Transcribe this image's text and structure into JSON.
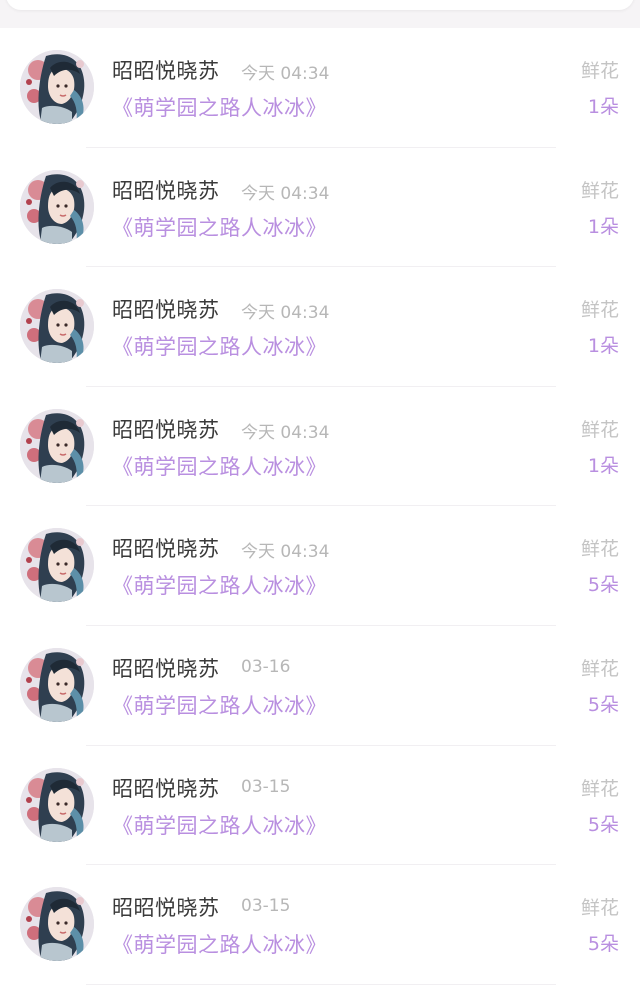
{
  "colors": {
    "accent_purple": "#b98fe0",
    "name_text": "#3a3a3a",
    "muted_text": "#b7b7b7",
    "background": "#ffffff",
    "page_background": "#f6f4f6"
  },
  "records": [
    {
      "user": "昭昭悦晓苏",
      "time": "今天 04:34",
      "book": "《萌学园之路人冰冰》",
      "gift_type": "鲜花",
      "gift_count": "1朵",
      "avatar_icon": "avatar-illustration"
    },
    {
      "user": "昭昭悦晓苏",
      "time": "今天 04:34",
      "book": "《萌学园之路人冰冰》",
      "gift_type": "鲜花",
      "gift_count": "1朵",
      "avatar_icon": "avatar-illustration"
    },
    {
      "user": "昭昭悦晓苏",
      "time": "今天 04:34",
      "book": "《萌学园之路人冰冰》",
      "gift_type": "鲜花",
      "gift_count": "1朵",
      "avatar_icon": "avatar-illustration"
    },
    {
      "user": "昭昭悦晓苏",
      "time": "今天 04:34",
      "book": "《萌学园之路人冰冰》",
      "gift_type": "鲜花",
      "gift_count": "1朵",
      "avatar_icon": "avatar-illustration"
    },
    {
      "user": "昭昭悦晓苏",
      "time": "今天 04:34",
      "book": "《萌学园之路人冰冰》",
      "gift_type": "鲜花",
      "gift_count": "5朵",
      "avatar_icon": "avatar-illustration"
    },
    {
      "user": "昭昭悦晓苏",
      "time": "03-16",
      "book": "《萌学园之路人冰冰》",
      "gift_type": "鲜花",
      "gift_count": "5朵",
      "avatar_icon": "avatar-illustration"
    },
    {
      "user": "昭昭悦晓苏",
      "time": "03-15",
      "book": "《萌学园之路人冰冰》",
      "gift_type": "鲜花",
      "gift_count": "5朵",
      "avatar_icon": "avatar-illustration"
    },
    {
      "user": "昭昭悦晓苏",
      "time": "03-15",
      "book": "《萌学园之路人冰冰》",
      "gift_type": "鲜花",
      "gift_count": "5朵",
      "avatar_icon": "avatar-illustration"
    }
  ]
}
